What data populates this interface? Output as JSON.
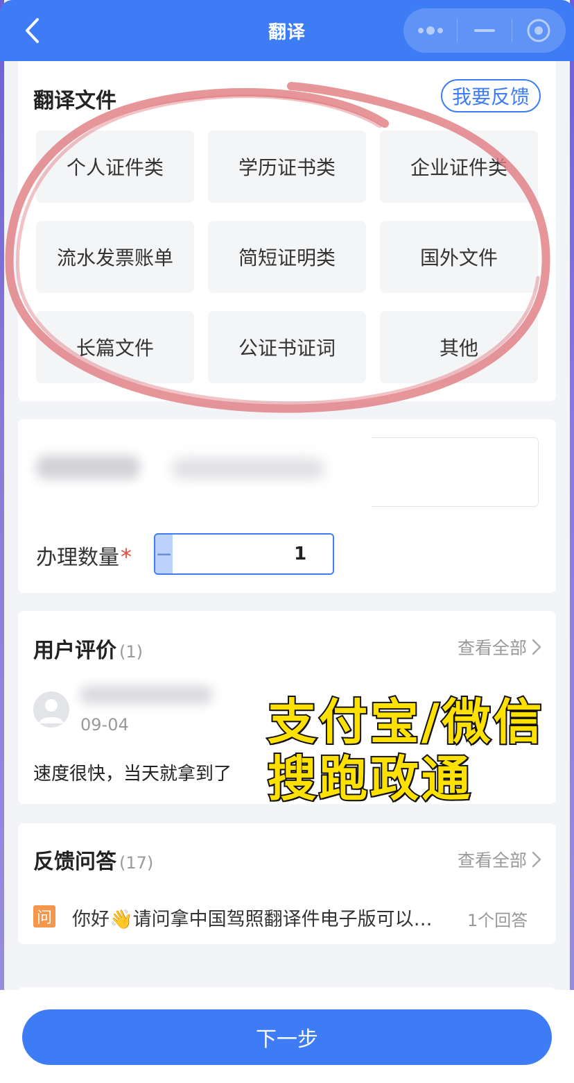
{
  "header": {
    "title": "翻译"
  },
  "translate_section": {
    "title": "翻译文件",
    "feedback_label": "我要反馈",
    "categories": [
      "个人证件类",
      "学历证书类",
      "企业证件类",
      "流水发票账单",
      "简短证明类",
      "国外文件",
      "长篇文件",
      "公证书证词",
      "其他"
    ]
  },
  "form": {
    "quantity_label": "办理数量",
    "required_mark": "*",
    "minus_symbol": "−",
    "plus_symbol": "+",
    "quantity_value": "1"
  },
  "reviews": {
    "title": "用户评价",
    "count": "(1)",
    "view_all": "查看全部",
    "items": [
      {
        "date": "09-04",
        "text": "速度很快，当天就拿到了"
      }
    ]
  },
  "overlay": {
    "line1": "支付宝/微信",
    "line2": "搜跑政通"
  },
  "qa": {
    "title": "反馈问答",
    "count": "(17)",
    "view_all": "查看全部",
    "badge": "问",
    "question": "你好👋请问拿中国驾照翻译件电子版可以…",
    "answers": "1个回答"
  },
  "bottom": {
    "next_label": "下一步"
  },
  "colors": {
    "primary": "#3d7cf5",
    "required": "#e94a3a",
    "overlay_fill": "#ffe100",
    "circle": "#e07a80",
    "qa_badge": "#f5974a"
  }
}
